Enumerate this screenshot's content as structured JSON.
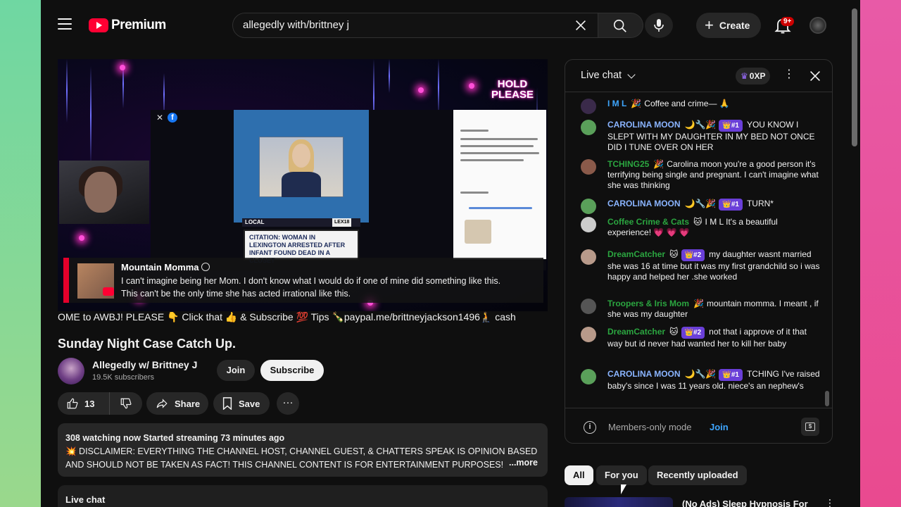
{
  "colors": {
    "accent": "#ff0033",
    "link": "#3ea6ff",
    "member_badge": "#6a3fd8",
    "background": "#0f0f0f"
  },
  "header": {
    "brand": "Premium",
    "search_value": "allegedly with/brittney j",
    "create_label": "Create",
    "notification_count": "9+"
  },
  "video": {
    "overlay_hold": "HOLD",
    "overlay_please": "PLEASE",
    "local_tag": "LOCAL",
    "lex_tag": "LEX18",
    "headline": "CITATION: WOMAN IN LEXINGTON ARRESTED AFTER INFANT FOUND DEAD IN A CLOSET",
    "comment_author": "Mountain Momma",
    "comment_line1": "I can't imagine being her Mom. I don't know what I would do if one of mine did something like this.",
    "comment_line2": "This can't be the only time she has acted irrational like this.",
    "ticker": "OME to AWBJ! PLEASE 👇 Click that 👍 & Subscribe 💯 Tips 🍾paypal.me/brittneyjackson1496🧎 cash"
  },
  "meta": {
    "title": "Sunday Night Case Catch Up.",
    "channel_name": "Allegedly w/ Brittney J",
    "subscribers": "19.5K subscribers",
    "join_label": "Join",
    "subscribe_label": "Subscribe",
    "like_count": "13",
    "share_label": "Share",
    "save_label": "Save",
    "more_label": "···"
  },
  "description": {
    "stats": "308 watching now  Started streaming 73 minutes ago",
    "line1": "💥 DISCLAIMER: EVERYTHING THE CHANNEL HOST, CHANNEL GUEST, & CHATTERS SPEAK IS OPINION BASED",
    "line2": "AND SHOULD NOT BE TAKEN AS FACT!  THIS CHANNEL CONTENT IS FOR ENTERTAINMENT PURPOSES!",
    "more": "...more"
  },
  "bottom_chat_label": "Live chat",
  "chat": {
    "title": "Live chat",
    "xp": "0XP",
    "messages": [
      {
        "name": "I M L",
        "color": "#3ea6ff",
        "emoji": "🎉",
        "badge": "",
        "text": "Coffee and crime— 🙏",
        "avatar": "#3a2a4a"
      },
      {
        "name": "CAROLINA MOON",
        "color": "#8ab4ff",
        "emoji": "🌙🔧🎉",
        "badge": "👑#1",
        "text": "YOU KNOW I SLEPT WITH MY DAUGHTER IN MY BED NOT ONCE DID I TUNE OVER ON HER",
        "avatar": "#5aa05a"
      },
      {
        "name": "TCHING25",
        "color": "#2ba640",
        "emoji": "🎉",
        "badge": "",
        "text": "Carolina moon you're a good person it's terrifying being single and pregnant. I can't imagine what she was thinking",
        "avatar": "#8a5a4a"
      },
      {
        "name": "CAROLINA MOON",
        "color": "#8ab4ff",
        "emoji": "🌙🔧🎉",
        "badge": "👑#1",
        "text": "TURN*",
        "avatar": "#5aa05a"
      },
      {
        "name": "Coffee Crime & Cats",
        "color": "#2ba640",
        "emoji": "🐱",
        "badge": "",
        "text": "I M L It's a beautiful experience! 💗 💗 💗",
        "avatar": "#ccc"
      },
      {
        "name": "DreamCatcher",
        "color": "#2ba640",
        "emoji": "🐱",
        "badge": "👑#2",
        "text": "my daughter wasnt married she was 16 at time but it was my first grandchild so i was happy and helped her .she worked",
        "avatar": "#b89a8a"
      },
      {
        "name": "Troopers & Iris Mom",
        "color": "#2ba640",
        "emoji": "🎉",
        "badge": "",
        "text": "mountain momma. I meant , if she was my daughter",
        "avatar": "#555"
      },
      {
        "name": "DreamCatcher",
        "color": "#2ba640",
        "emoji": "🐱",
        "badge": "👑#2",
        "text": "not that i approve of it that way but id never had wanted her to kill her baby",
        "avatar": "#b89a8a"
      },
      {
        "name": "CAROLINA MOON",
        "color": "#8ab4ff",
        "emoji": "🌙🔧🎉",
        "badge": "👑#1",
        "text": "TCHING I've raised baby's since I was 11 years old. niece's an nephew's",
        "avatar": "#5aa05a"
      }
    ],
    "members_text": "Members-only mode",
    "join_link": "Join"
  },
  "chips": [
    "All",
    "For you",
    "Recently uploaded"
  ],
  "recommendation": {
    "title": "(No Ads) Sleep Hypnosis For"
  }
}
